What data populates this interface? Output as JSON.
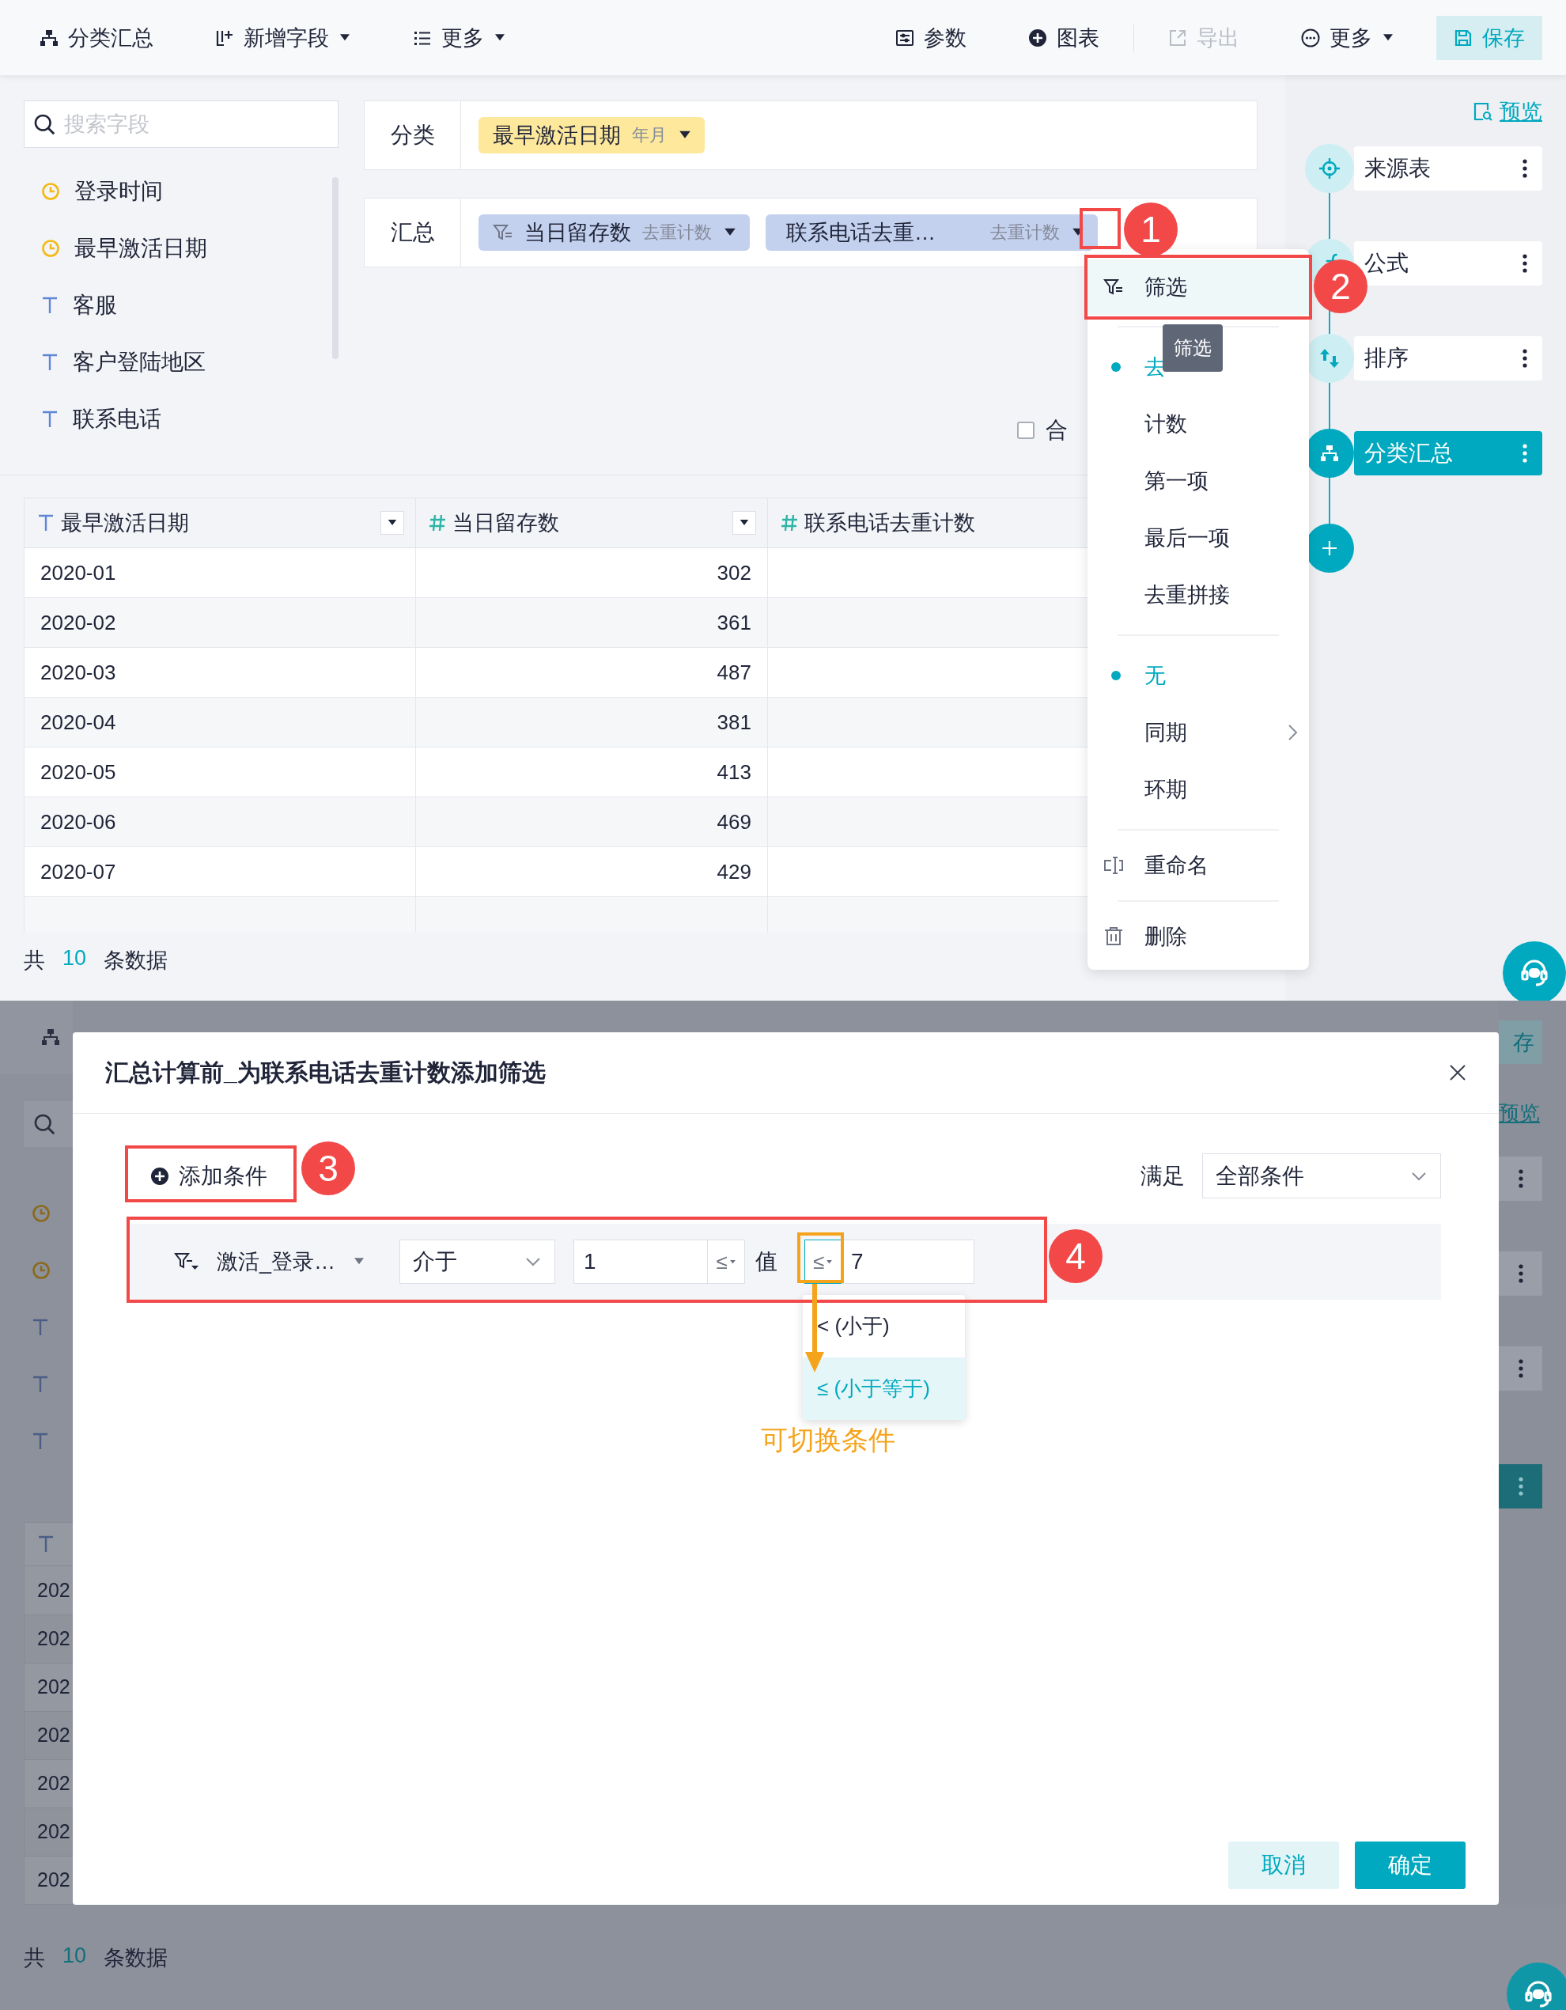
{
  "toolbar": {
    "left": [
      {
        "label": "分类汇总",
        "caret": false,
        "disabled": false
      },
      {
        "label": "新增字段",
        "caret": true,
        "disabled": false
      },
      {
        "label": "更多",
        "caret": true,
        "disabled": false
      }
    ],
    "right": [
      {
        "label": "参数",
        "caret": false,
        "disabled": false
      },
      {
        "label": "图表",
        "caret": false,
        "disabled": false
      },
      {
        "label": "导出",
        "caret": false,
        "disabled": true
      },
      {
        "label": "更多",
        "caret": true,
        "disabled": false
      }
    ],
    "save_button": "保存"
  },
  "field_search": {
    "placeholder": "搜索字段"
  },
  "fields": [
    {
      "kind": "date",
      "name": "登录时间"
    },
    {
      "kind": "date",
      "name": "最早激活日期"
    },
    {
      "kind": "text",
      "name": "客服"
    },
    {
      "kind": "text",
      "name": "客户登陆地区"
    },
    {
      "kind": "text",
      "name": "联系电话"
    }
  ],
  "dimension": {
    "label": "分类",
    "chips": [
      {
        "name": "最早激活日期",
        "aggregation": "年月",
        "filtered": false
      }
    ]
  },
  "measure": {
    "label": "汇总",
    "chips": [
      {
        "name": "当日留存数",
        "aggregation": "去重计数",
        "filtered": true
      },
      {
        "name": "联系电话去重…",
        "aggregation": "去重计数",
        "filtered": false
      }
    ]
  },
  "merge_checkbox": {
    "label": "合",
    "checked": false
  },
  "table": {
    "columns": [
      {
        "kind": "text",
        "name": "最早激活日期",
        "sortable": true
      },
      {
        "kind": "number",
        "name": "当日留存数",
        "sortable": true
      },
      {
        "kind": "number",
        "name": "联系电话去重计数",
        "sortable": false
      }
    ],
    "rows": [
      [
        "2020-01",
        "302"
      ],
      [
        "2020-02",
        "361"
      ],
      [
        "2020-03",
        "487"
      ],
      [
        "2020-04",
        "381"
      ],
      [
        "2020-05",
        "413"
      ],
      [
        "2020-06",
        "469"
      ],
      [
        "2020-07",
        "429"
      ]
    ]
  },
  "footer": {
    "prefix": "共",
    "count": "10",
    "suffix": "条数据"
  },
  "pipeline": {
    "preview": "预览",
    "steps": [
      {
        "name": "来源表",
        "selected": false
      },
      {
        "name": "公式",
        "selected": false
      },
      {
        "name": "排序",
        "selected": false
      },
      {
        "name": "分类汇总",
        "selected": true
      }
    ]
  },
  "context_menu": {
    "items": [
      {
        "kind": "action",
        "label": "筛选",
        "highlighted": true
      },
      {
        "kind": "divider"
      },
      {
        "kind": "option",
        "label": "去",
        "selected": true
      },
      {
        "kind": "option",
        "label": "计数",
        "selected": false
      },
      {
        "kind": "option",
        "label": "第一项",
        "selected": false
      },
      {
        "kind": "option",
        "label": "最后一项",
        "selected": false
      },
      {
        "kind": "option",
        "label": "去重拼接",
        "selected": false
      },
      {
        "kind": "divider"
      },
      {
        "kind": "option",
        "label": "无",
        "selected": true
      },
      {
        "kind": "submenu",
        "label": "同期",
        "selected": false
      },
      {
        "kind": "option",
        "label": "环期",
        "selected": false
      },
      {
        "kind": "divider"
      },
      {
        "kind": "action",
        "label": "重命名",
        "highlighted": false
      },
      {
        "kind": "divider"
      },
      {
        "kind": "action",
        "label": "删除",
        "highlighted": false
      }
    ],
    "tooltip": "筛选"
  },
  "annotations": {
    "markers": [
      "1",
      "2"
    ]
  },
  "backdrop": {
    "save_button": "存",
    "preview": "预览",
    "fields": [
      {
        "kind": "date"
      },
      {
        "kind": "date"
      },
      {
        "kind": "text"
      },
      {
        "kind": "text"
      },
      {
        "kind": "text"
      }
    ],
    "cells": [
      "202",
      "202",
      "202",
      "202",
      "202",
      "202",
      "202"
    ],
    "steps": [
      {
        "selected": false
      },
      {
        "selected": false
      },
      {
        "selected": false
      },
      {
        "selected": true
      }
    ],
    "footer": {
      "prefix": "共",
      "count": "10",
      "suffix": "条数据"
    }
  },
  "dialog": {
    "title": "汇总计算前_为联系电话去重计数添加筛选",
    "add_condition": "添加条件",
    "match_label": "满足",
    "match_value": "全部条件",
    "condition": {
      "field": "激活_登录…",
      "operator": "介于",
      "min": "1",
      "min_op": "≤",
      "value_label": "值",
      "max_op": "≤",
      "max": "7"
    },
    "operator_menu": [
      {
        "symbol": "<",
        "label": "(小于)",
        "selected": false
      },
      {
        "symbol": "≤",
        "label": "(小于等于)",
        "selected": true
      }
    ],
    "buttons": [
      {
        "kind": "secondary",
        "label": "取消"
      },
      {
        "kind": "primary",
        "label": "确定"
      }
    ],
    "markers": [
      "3",
      "4"
    ],
    "hint": "可切换条件"
  }
}
